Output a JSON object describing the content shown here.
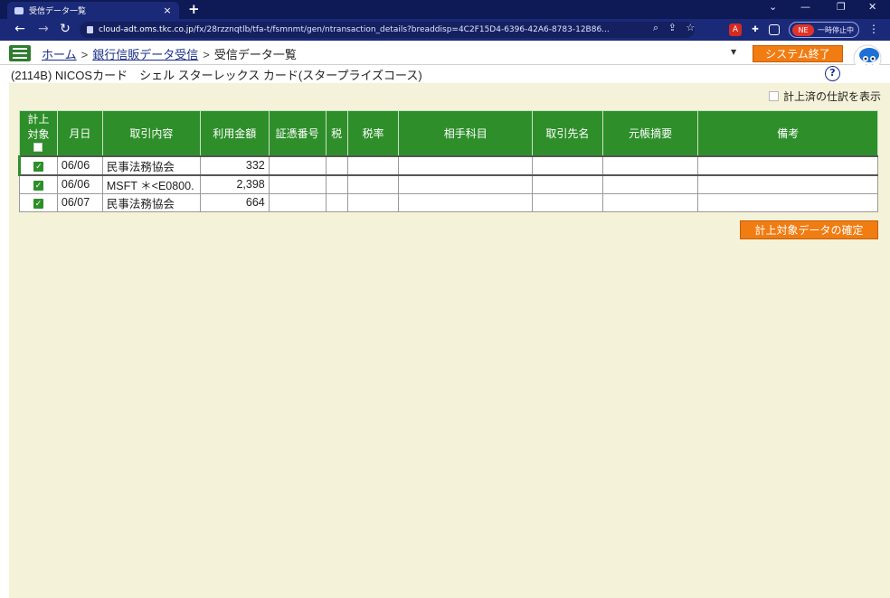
{
  "browser": {
    "tab_title": "受信データ一覧",
    "tab_close": "×",
    "new_tab": "+",
    "url_host": "cloud-adt.oms.tkc.co.jp",
    "url_rest": "/fx/28rzznqtlb/tfa-t/fsmnmt/gen/ntransaction_details?breaddisp=4C2F15D4-6396-42A6-8783-12B86...",
    "pause_badge": "NE",
    "pause_label": "一時停止中"
  },
  "header": {
    "breadcrumbs": [
      "ホーム",
      "銀行信販データ受信",
      "受信データ一覧"
    ],
    "separator": ">",
    "system_end_label": "システム終了",
    "dropdown_arrow": "▼"
  },
  "subheader": {
    "account_title": "(2114B) NICOSカード　シェル スターレックス カード(スタープライズコース)",
    "help_label": "?"
  },
  "content": {
    "show_posted_label": "計上済の仕訳を表示",
    "table": {
      "headers": {
        "check_line1": "計上",
        "check_line2": "対象",
        "date": "月日",
        "description": "取引内容",
        "amount": "利用金額",
        "voucher_no": "証憑番号",
        "tax": "税",
        "tax_rate": "税率",
        "counter_account": "相手科目",
        "partner": "取引先名",
        "ledger_memo": "元帳摘要",
        "remarks": "備考"
      },
      "rows": [
        {
          "checked": "✓",
          "date": "06/06",
          "description": "民事法務協会",
          "amount": "332",
          "voucher_no": "",
          "tax": "",
          "tax_rate": "",
          "counter_account": "",
          "partner": "",
          "ledger_memo": "",
          "remarks": ""
        },
        {
          "checked": "✓",
          "date": "06/06",
          "description": "MSFT ＊<E0800.",
          "amount": "2,398",
          "voucher_no": "",
          "tax": "",
          "tax_rate": "",
          "counter_account": "",
          "partner": "",
          "ledger_memo": "",
          "remarks": ""
        },
        {
          "checked": "✓",
          "date": "06/07",
          "description": "民事法務協会",
          "amount": "664",
          "voucher_no": "",
          "tax": "",
          "tax_rate": "",
          "counter_account": "",
          "partner": "",
          "ledger_memo": "",
          "remarks": ""
        }
      ]
    },
    "confirm_label": "計上対象データの確定"
  },
  "colors": {
    "chrome_dark": "#0e1a56",
    "accent_green": "#2e8f2a",
    "accent_orange": "#f07c12",
    "content_bg": "#f5f2da"
  }
}
